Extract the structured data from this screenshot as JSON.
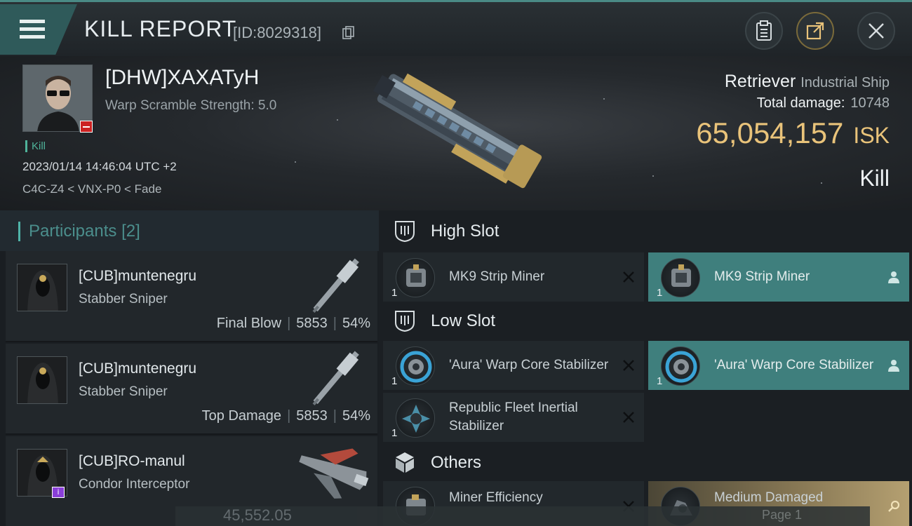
{
  "header": {
    "title": "KILL REPORT",
    "id_text": "[ID:8029318]",
    "buttons": [
      "clipboard-icon",
      "share-icon",
      "close-icon"
    ]
  },
  "victim": {
    "name": "[DHW]XAXATyH",
    "warp_scramble": "Warp Scramble Strength: 5.0",
    "kill_tag": "Kill",
    "datetime": "2023/01/14 14:46:04 UTC +2",
    "location": "C4C-Z4 < VNX-P0 < Fade"
  },
  "ship": {
    "name": "Retriever",
    "class": "Industrial Ship",
    "total_damage_label": "Total damage:",
    "total_damage": "10748",
    "isk_value": "65,054,157",
    "isk_unit": "ISK",
    "result": "Kill"
  },
  "participants": {
    "label": "Participants",
    "count": "[2]",
    "rows": [
      {
        "name": "[CUB]muntenegru",
        "ship": "Stabber Sniper",
        "tag": "Final Blow",
        "damage": "5853",
        "percent": "54%"
      },
      {
        "name": "[CUB]muntenegru",
        "ship": "Stabber Sniper",
        "tag": "Top Damage",
        "damage": "5853",
        "percent": "54%"
      },
      {
        "name": "[CUB]RO-manul",
        "ship": "Condor Interceptor",
        "tag": "",
        "damage": "",
        "percent": ""
      }
    ]
  },
  "slots": {
    "high": {
      "label": "High Slot",
      "destroyed": [
        {
          "name": "MK9 Strip Miner",
          "qty": "1"
        }
      ],
      "dropped": [
        {
          "name": "MK9 Strip Miner",
          "qty": "1"
        }
      ]
    },
    "low": {
      "label": "Low Slot",
      "destroyed": [
        {
          "name": "'Aura' Warp Core Stabilizer",
          "qty": "1"
        },
        {
          "name": "Republic Fleet Inertial Stabilizer",
          "qty": "1"
        }
      ],
      "dropped": [
        {
          "name": "'Aura' Warp Core Stabilizer",
          "qty": "1"
        }
      ]
    },
    "others": {
      "label": "Others",
      "destroyed": [
        {
          "name": "Miner Efficiency",
          "qty": ""
        }
      ],
      "dropped": [
        {
          "name": "Medium Damaged",
          "qty": ""
        }
      ]
    }
  },
  "footer": {
    "value": "45,552.05",
    "page": "Page 1"
  },
  "colors": {
    "accent": "#4fb3a8",
    "isk": "#e9c37a",
    "dropped": "#3f7f7d"
  }
}
